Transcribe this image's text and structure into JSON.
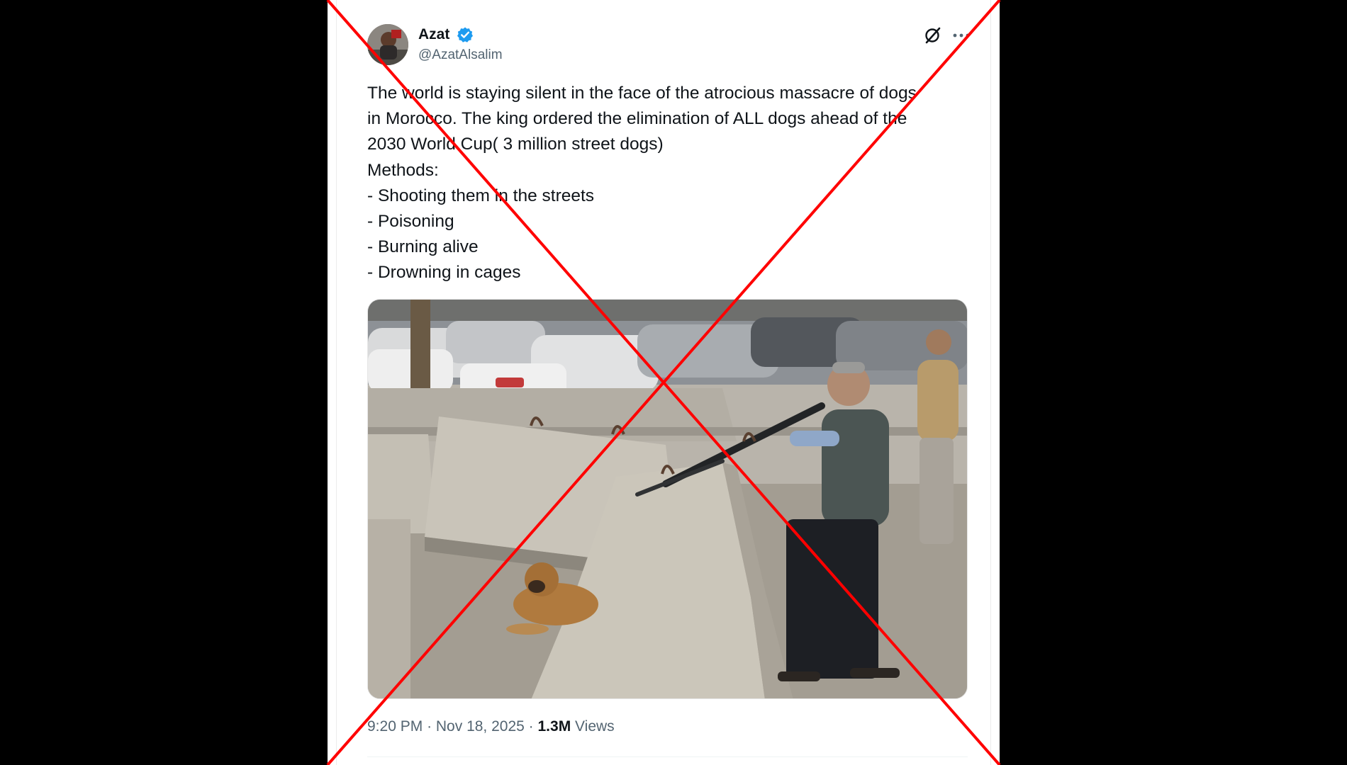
{
  "tweet": {
    "author": {
      "display_name": "Azat",
      "handle": "@AzatAlsalim",
      "verified": true,
      "verified_color": "#1d9bf0"
    },
    "text_lines": [
      "The world is staying silent in the face of the atrocious massacre of dogs",
      "in Morocco. The king ordered the elimination of ALL dogs ahead of the",
      "2030 World Cup( 3 million street dogs)",
      "Methods:",
      "- Shooting them in the streets",
      "- Poisoning",
      "- Burning alive",
      "- Drowning in cages"
    ],
    "footer": {
      "time": "9:20 PM",
      "separator": "·",
      "date": "Nov 18, 2025",
      "views_count": "1.3M",
      "views_label": "Views"
    },
    "icons": {
      "grok": "grok-icon",
      "more": "more-icon",
      "verified": "verified-badge-icon"
    }
  },
  "overlay": {
    "cross_color": "#ff0000"
  },
  "colors": {
    "background": "#000000",
    "card": "#ffffff",
    "text_primary": "#0f1419",
    "text_secondary": "#536471"
  }
}
